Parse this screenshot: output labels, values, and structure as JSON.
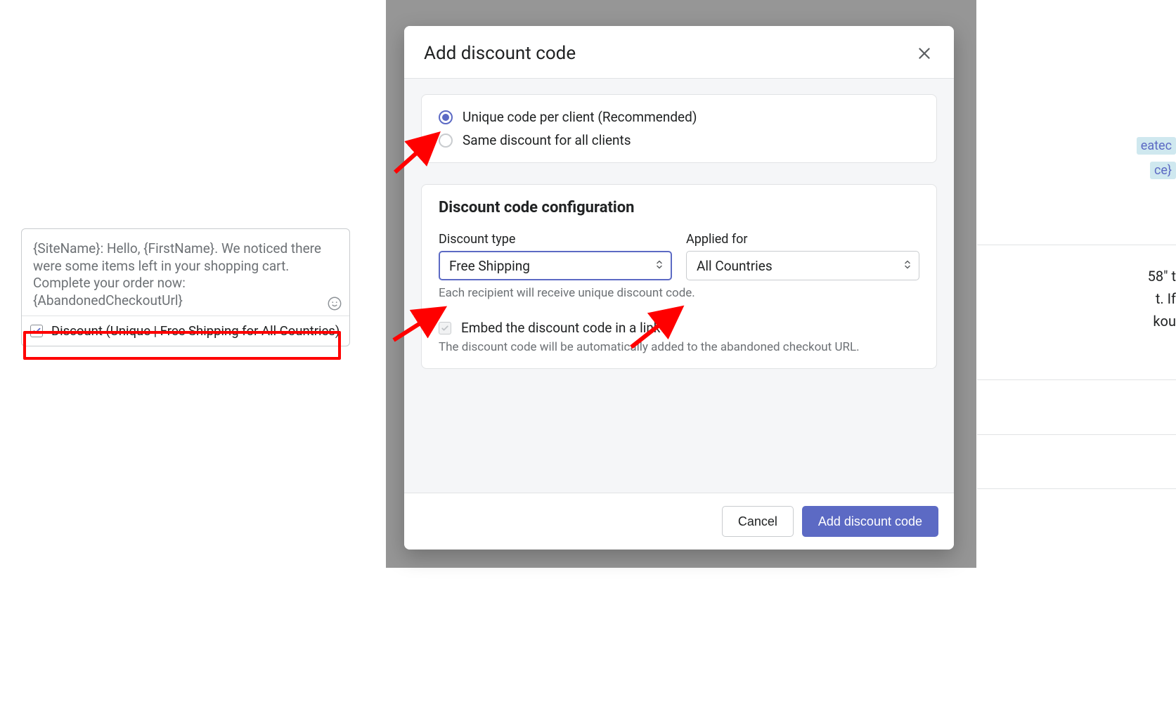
{
  "left": {
    "textarea_text": "{SiteName}: Hello, {FirstName}. We noticed there were some items left in your shopping cart. Complete your order now: {AbandonedCheckoutUrl}",
    "discount_label": "Discount (Unique | Free Shipping for All Countries)"
  },
  "modal": {
    "title": "Add discount code",
    "radio_unique": "Unique code per client (Recommended)",
    "radio_same": "Same discount for all clients",
    "config_title": "Discount code configuration",
    "discount_type_label": "Discount type",
    "discount_type_value": "Free Shipping",
    "applied_for_label": "Applied for",
    "applied_for_value": "All Countries",
    "hint_unique": "Each recipient will receive unique discount code.",
    "embed_label": "Embed the discount code in a link",
    "embed_help": "The discount code will be automatically added to the abandoned checkout URL.",
    "cancel": "Cancel",
    "submit": "Add discount code"
  },
  "bg": {
    "tag1": "eatec",
    "tag2": "ce}",
    "frag1": "58\" t",
    "frag2": "t. If",
    "frag3": "kou"
  }
}
